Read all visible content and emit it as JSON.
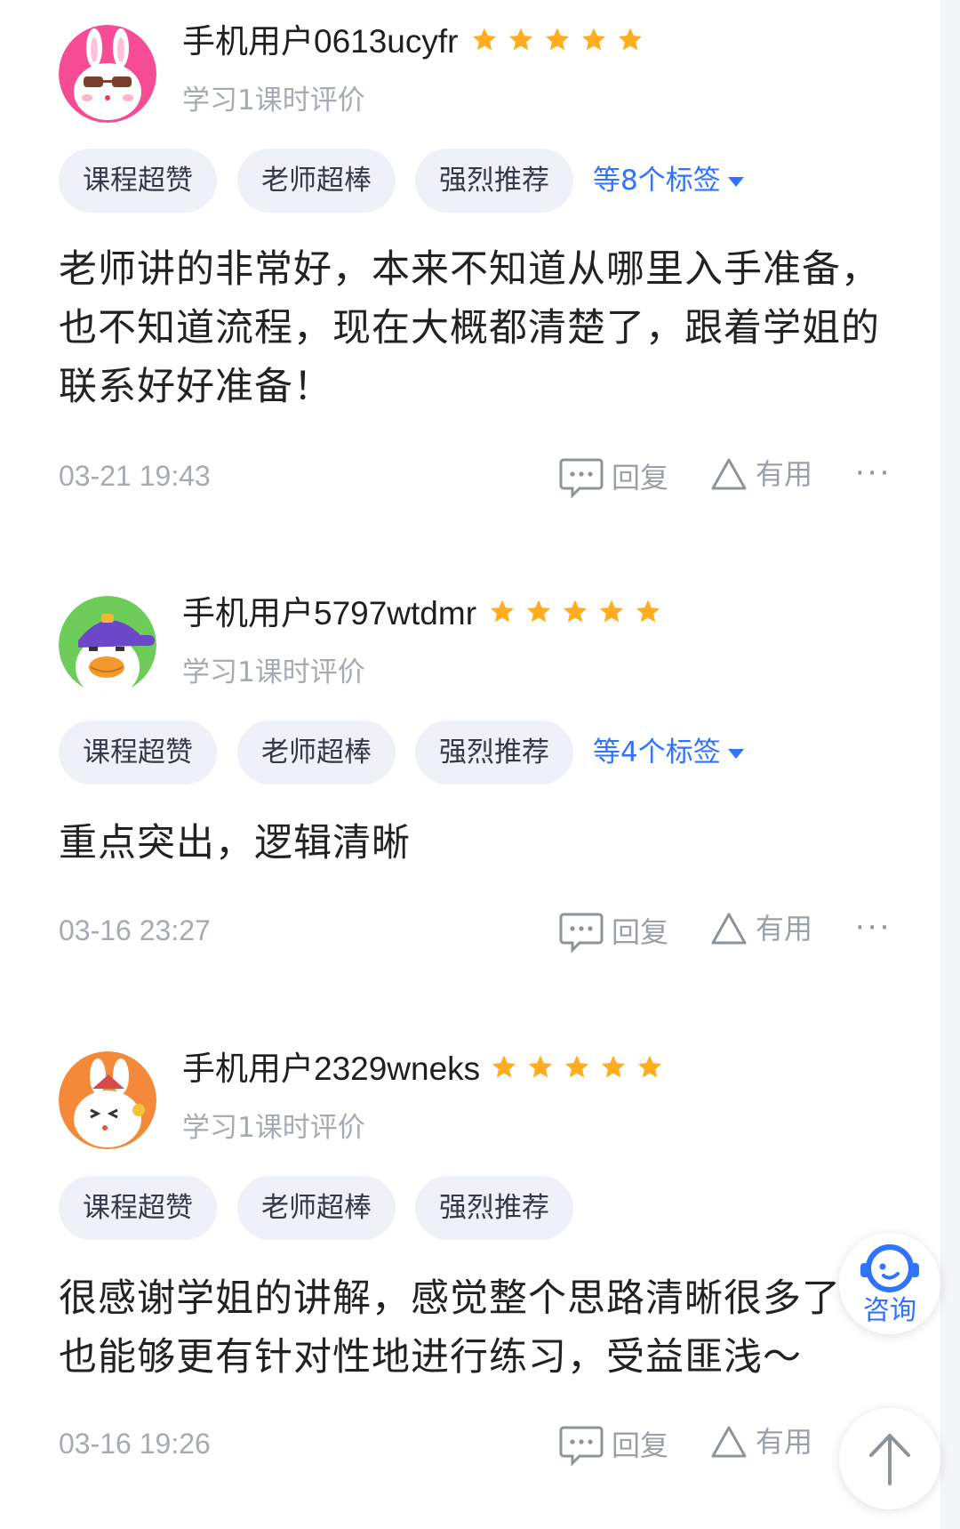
{
  "colors": {
    "accent": "#2f73ff",
    "star": "#ffad1f",
    "tag_bg": "#eef1f8",
    "muted": "#a6aab3"
  },
  "actions": {
    "reply_label": "回复",
    "useful_label": "有用",
    "more_label": "···"
  },
  "reviews": [
    {
      "username": "手机用户0613ucyfr",
      "rating": 5,
      "subtitle": "学习1课时评价",
      "tags": [
        "课程超赞",
        "老师超棒",
        "强烈推荐"
      ],
      "more_tags": "等8个标签",
      "text": "老师讲的非常好，本来不知道从哪里入手准备，也不知道流程，现在大概都清楚了，跟着学姐的联系好好准备！",
      "time": "03-21 19:43",
      "avatar": "pink-bunny-avatar"
    },
    {
      "username": "手机用户5797wtdmr",
      "rating": 5,
      "subtitle": "学习1课时评价",
      "tags": [
        "课程超赞",
        "老师超棒",
        "强烈推荐"
      ],
      "more_tags": "等4个标签",
      "text": "重点突出，逻辑清晰",
      "time": "03-16 23:27",
      "avatar": "green-duck-avatar"
    },
    {
      "username": "手机用户2329wneks",
      "rating": 5,
      "subtitle": "学习1课时评价",
      "tags": [
        "课程超赞",
        "老师超棒",
        "强烈推荐"
      ],
      "text": "很感谢学姐的讲解，感觉整个思路清晰很多了也能够更有针对性地进行练习，受益匪浅～",
      "time": "03-16 19:26",
      "avatar": "orange-bunny-avatar"
    }
  ],
  "floating": {
    "consult_label": "咨询",
    "consult_icon": "customer-service-icon",
    "top_icon": "arrow-up-icon"
  }
}
